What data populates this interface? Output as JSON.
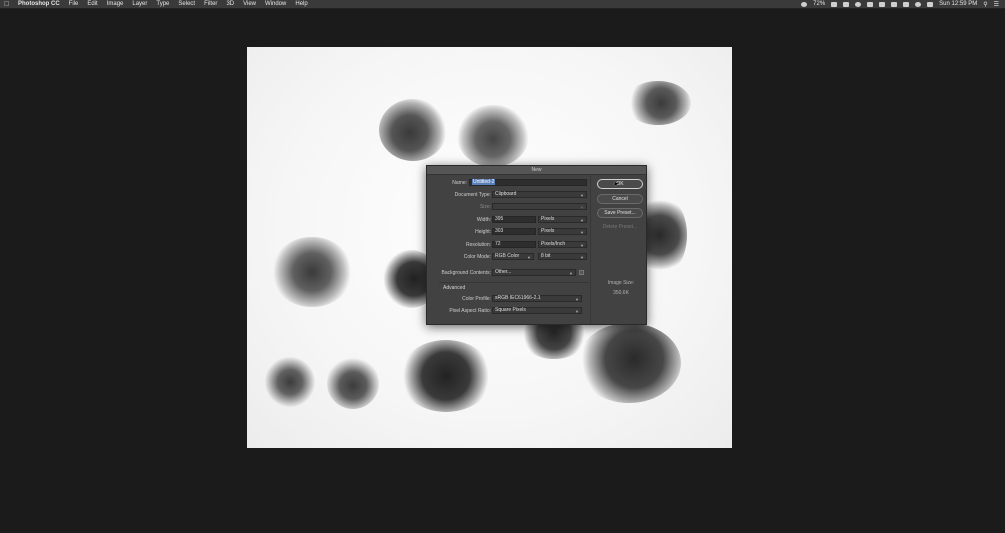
{
  "menubar": {
    "app_name": "Photoshop CC",
    "menus": [
      "File",
      "Edit",
      "Image",
      "Layer",
      "Type",
      "Select",
      "Filter",
      "3D",
      "View",
      "Window",
      "Help"
    ],
    "battery": "72%",
    "clock": "Sun 12:59 PM"
  },
  "dialog": {
    "title": "New",
    "name_label": "Name:",
    "name_value": "Untitled-2",
    "document_type_label": "Document Type:",
    "document_type_value": "Clipboard",
    "size_label": "Size:",
    "width_label": "Width:",
    "width_value": "395",
    "width_unit": "Pixels",
    "height_label": "Height:",
    "height_value": "303",
    "height_unit": "Pixels",
    "resolution_label": "Resolution:",
    "resolution_value": "72",
    "resolution_unit": "Pixels/Inch",
    "color_mode_label": "Color Mode:",
    "color_mode_value": "RGB Color",
    "bit_depth_value": "8 bit",
    "background_label": "Background Contents:",
    "background_value": "Other...",
    "advanced_label": "Advanced",
    "color_profile_label": "Color Profile:",
    "color_profile_value": "sRGB IEC61966-2.1",
    "pixel_aspect_label": "Pixel Aspect Ratio:",
    "pixel_aspect_value": "Square Pixels",
    "ok_label": "OK",
    "cancel_label": "Cancel",
    "save_preset_label": "Save Preset...",
    "delete_preset_label": "Delete Preset...",
    "image_size_label": "Image Size:",
    "image_size_value": "350.6K"
  },
  "colors": {
    "background": "#1b1b1b",
    "dialog": "#424242",
    "selection": "#5b7fb8"
  }
}
